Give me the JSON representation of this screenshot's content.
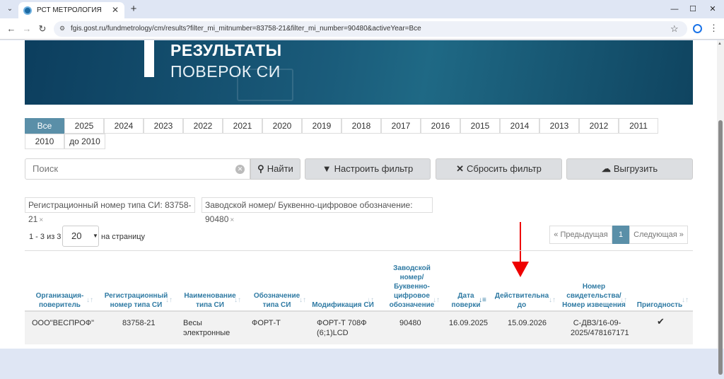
{
  "browser": {
    "tab_title": "РСТ МЕТРОЛОГИЯ",
    "url": "fgis.gost.ru/fundmetrology/cm/results?filter_mi_mitnumber=83758-21&filter_mi_number=90480&activeYear=Все"
  },
  "hero": {
    "title_line1": "РЕЗУЛЬТАТЫ",
    "title_line2": "ПОВЕРОК СИ"
  },
  "years": [
    "Все",
    "2025",
    "2024",
    "2023",
    "2022",
    "2021",
    "2020",
    "2019",
    "2018",
    "2017",
    "2016",
    "2015",
    "2014",
    "2013",
    "2012",
    "2011",
    "2010",
    "до 2010"
  ],
  "active_year": "Все",
  "search": {
    "placeholder": "Поиск",
    "find_label": "Найти"
  },
  "actions": {
    "filter_label": "Настроить фильтр",
    "reset_label": "Сбросить фильтр",
    "export_label": "Выгрузить"
  },
  "filters": [
    "Регистрационный номер типа СИ: 83758-21",
    "Заводской номер/ Буквенно-цифровое обозначение: 90480"
  ],
  "paging": {
    "count_text": "1 - 3 из 3",
    "per_page": "20",
    "per_page_label": "на страницу",
    "prev": "Предыдущая",
    "current": "1",
    "next": "Следующая"
  },
  "columns": [
    "Организация-поверитель",
    "Регистрационный номер типа СИ",
    "Наименование типа СИ",
    "Обозначение типа СИ",
    "Модификация СИ",
    "Заводской номер/ Буквенно-цифровое обозначение",
    "Дата поверки",
    "Действительна до",
    "Номер свидетельства/ Номер извещения",
    "Пригодность"
  ],
  "rows": [
    {
      "org": "ООО\"ВЕСПРОФ\"",
      "reg_number": "83758-21",
      "type_name": "Весы электронные",
      "designation": "ФОРТ-Т",
      "modification": "ФОРТ-Т 708Ф (6;1)LCD",
      "serial": "90480",
      "date": "16.09.2025",
      "valid_until": "15.09.2026",
      "certificate": "С-ДВЗ/16-09-2025/478167171"
    }
  ]
}
